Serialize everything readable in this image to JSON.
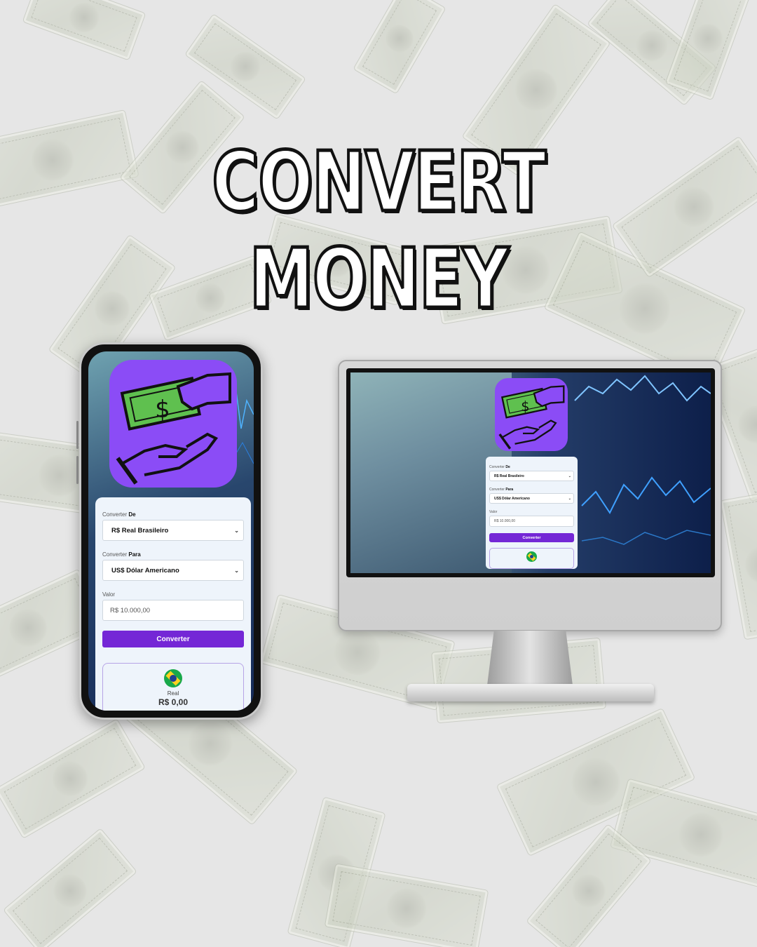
{
  "title": "CONVERT MONEY",
  "app_icon": {
    "symbol": "$",
    "icon_name": "money-hand-icon",
    "background_color": "#8b4cf6"
  },
  "form": {
    "from_label": "Converter",
    "from_label_bold": "De",
    "from_value": "R$ Real Brasileiro",
    "to_label": "Converter",
    "to_label_bold": "Para",
    "to_value": "US$ Dólar Americano",
    "amount_label": "Valor",
    "amount_value": "R$ 10.000,00",
    "button_label": "Converter",
    "button_color": "#7427d6"
  },
  "result": {
    "flag_icon": "brazil-flag-icon",
    "currency_name": "Real",
    "amount": "R$ 0,00"
  }
}
